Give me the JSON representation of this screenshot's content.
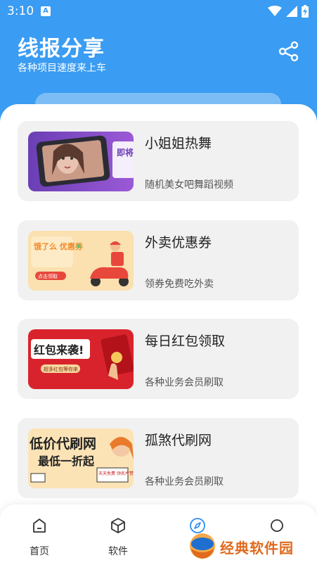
{
  "status_bar": {
    "time": "3:10",
    "notif_letter": "A"
  },
  "header": {
    "title": "线报分享",
    "subtitle": "各种项目速度来上车",
    "share_icon": "share-icon",
    "bg_color": "#3a9cf2"
  },
  "cards": [
    {
      "title": "小姐姐热舞",
      "desc": "随机美女吧舞蹈视频",
      "thumb_text": "即将播放"
    },
    {
      "title": "外卖优惠券",
      "desc": "领券免费吃外卖",
      "thumb_text": "饿了么 优惠券",
      "thumb_button": "点击领取"
    },
    {
      "title": "每日红包领取",
      "desc": "各种业务会员刷取",
      "thumb_text": "红包来袭!",
      "thumb_button": "超多红包等你来"
    },
    {
      "title": "孤煞代刷网",
      "desc": "各种业务会员刷取",
      "thumb_text_1": "低价代刷网",
      "thumb_text_2": "最低一折起",
      "thumb_note": "天天免费 领名片赞"
    }
  ],
  "bottom_nav": [
    {
      "label": "首页",
      "icon": "home-icon"
    },
    {
      "label": "软件",
      "icon": "cube-icon"
    },
    {
      "label": "",
      "icon": "compass-icon",
      "active": true
    },
    {
      "label": "",
      "icon": "circle-icon"
    }
  ],
  "watermark": {
    "text": "经典软件园"
  }
}
